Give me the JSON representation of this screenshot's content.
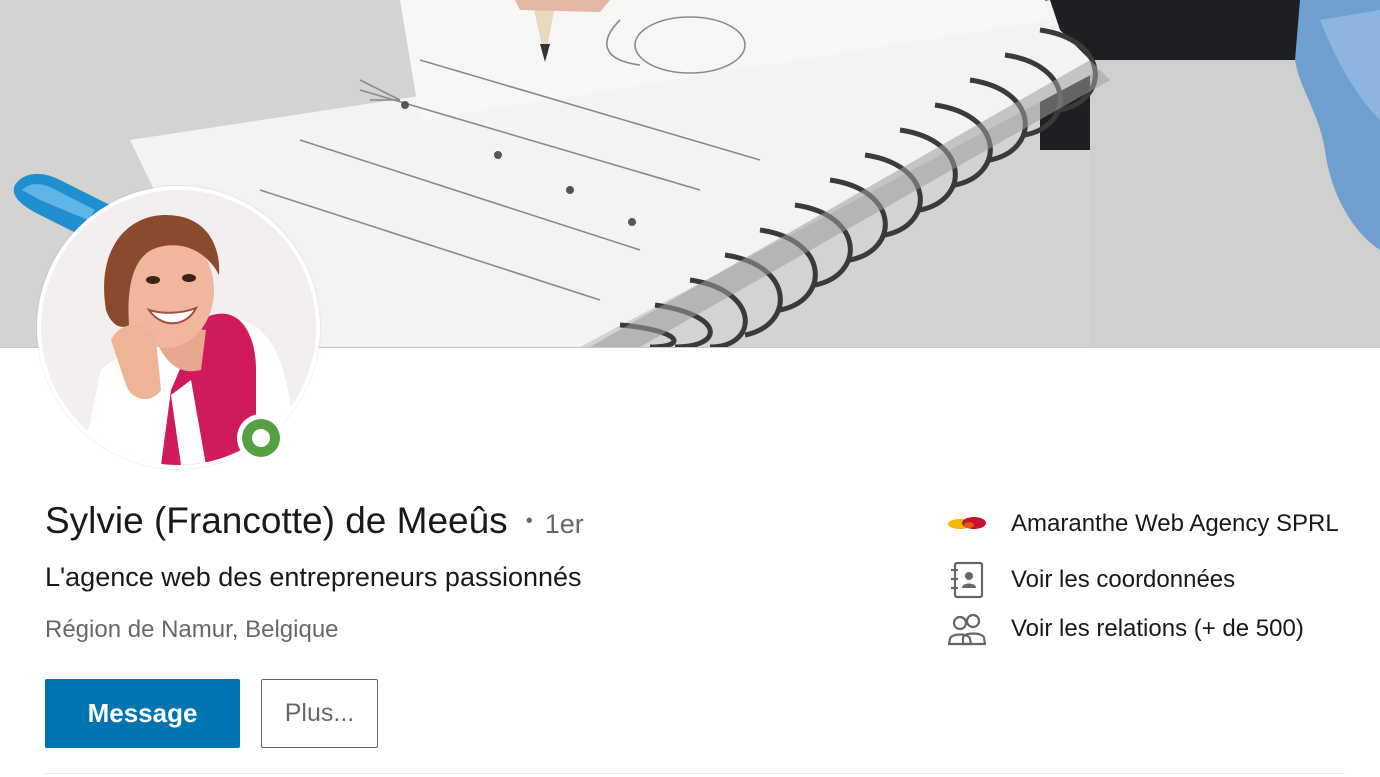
{
  "profile": {
    "name": "Sylvie (Francotte) de Meeûs",
    "degree_separator": "•",
    "degree": "1er",
    "headline": "L'agence web des entrepreneurs passionnés",
    "location": "Région de Namur, Belgique",
    "presence_status": "online"
  },
  "actions": {
    "message_label": "Message",
    "more_label": "Plus..."
  },
  "sidebar": {
    "items": [
      {
        "label": "Amaranthe Web Agency SPRL",
        "icon": "company-logo-icon"
      },
      {
        "label": "Voir les coordonnées",
        "icon": "contact-book-icon"
      },
      {
        "label": "Voir les relations (+ de 500)",
        "icon": "people-icon"
      }
    ]
  },
  "colors": {
    "primary_button": "#0073b1",
    "presence_green": "#57a041",
    "logo_red": "#c8102e",
    "logo_yellow": "#f2b705"
  }
}
